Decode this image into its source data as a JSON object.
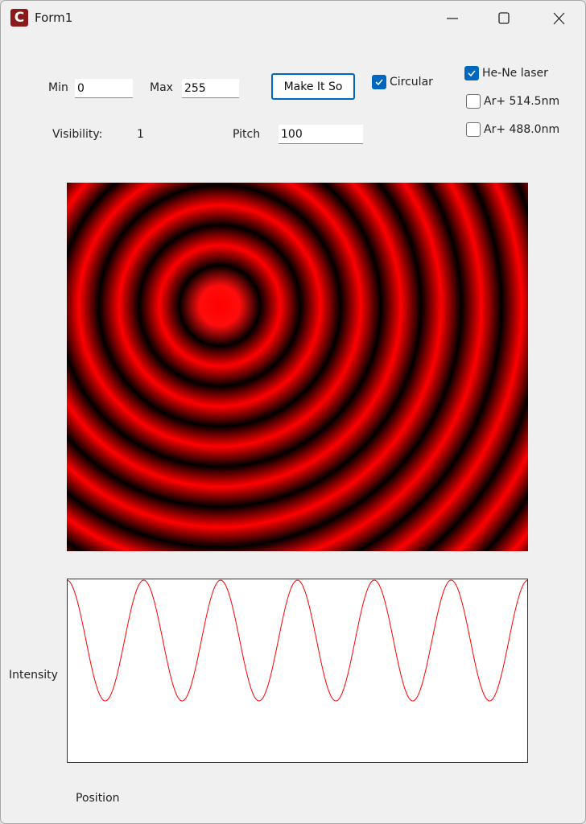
{
  "window": {
    "title": "Form1",
    "icon_letter": "C",
    "icon": "app-c-icon",
    "controls": [
      "minimize-icon",
      "maximize-icon",
      "close-icon"
    ]
  },
  "controls": {
    "min_label": "Min",
    "min_value": "0",
    "max_label": "Max",
    "max_value": "255",
    "make_button": "Make It So",
    "circular_label": "Circular",
    "circular_checked": true,
    "visibility_label": "Visibility:",
    "visibility_value": "1",
    "pitch_label": "Pitch",
    "pitch_value": "100"
  },
  "lasers": [
    {
      "label": "He-Ne laser",
      "checked": true
    },
    {
      "label": "Ar+ 514.5nm",
      "checked": false
    },
    {
      "label": "Ar+ 488.0nm",
      "checked": false
    }
  ],
  "colors": {
    "fringe": "#ff0000",
    "background": "#000000",
    "accent": "#0067c0",
    "curve": "#ff0000"
  },
  "chart_data": {
    "type": "line",
    "title": "",
    "xlabel": "Position",
    "ylabel": "Intensity",
    "cycles": 6,
    "min_level": 0.33,
    "max_level": 1.0,
    "grid": false
  }
}
